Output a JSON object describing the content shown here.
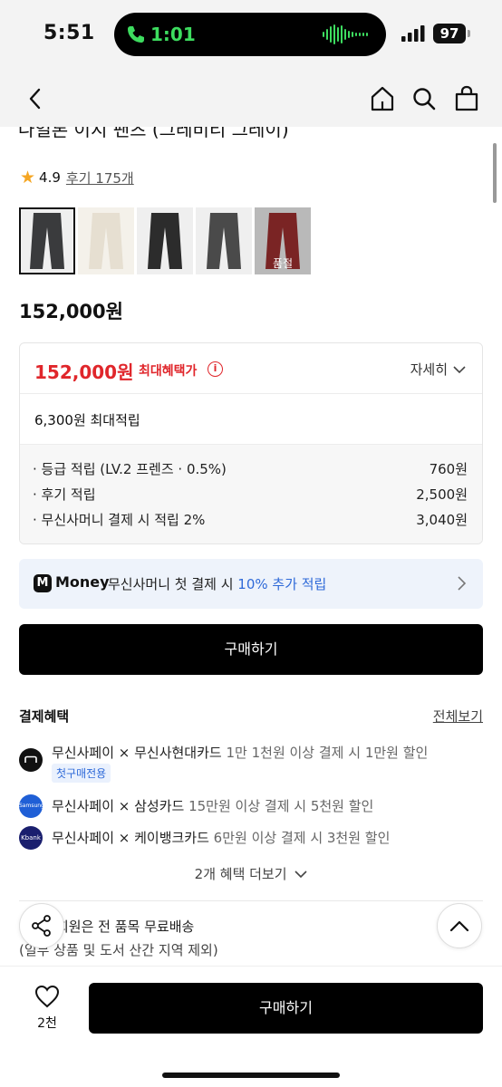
{
  "status": {
    "time": "5:51",
    "call_time": "1:01",
    "battery": "97"
  },
  "nav": {
    "back_icon": "chevron-left-icon",
    "home_icon": "home-icon",
    "search_icon": "search-icon",
    "bag_icon": "bag-icon"
  },
  "product": {
    "title": "나일론 이지 팬츠 (그레비티 그레이)",
    "rating": "4.9",
    "reviews": "후기 175개",
    "price": "152,000원",
    "thumbnails": [
      {
        "color": "#3a3b3d",
        "selected": true,
        "sold_out": ""
      },
      {
        "color": "#e6dfd1",
        "selected": false,
        "sold_out": ""
      },
      {
        "color": "#2c2c2c",
        "selected": false,
        "sold_out": ""
      },
      {
        "color": "#4a4a4a",
        "selected": false,
        "sold_out": ""
      },
      {
        "color": "#7a2424",
        "selected": false,
        "sold_out": "품절"
      }
    ]
  },
  "benefit": {
    "max_price": "152,000원",
    "max_label": "최대혜택가",
    "detail_toggle": "자세히",
    "points_total": "6,300원 최대적립",
    "points": [
      {
        "label": "· 등급 적립 (LV.2 프렌즈 · 0.5%)",
        "amount": "760원"
      },
      {
        "label": "· 후기 적립",
        "amount": "2,500원"
      },
      {
        "label": "· 무신사머니 결제 시 적립 2%",
        "amount": "3,040원"
      }
    ]
  },
  "money": {
    "logo": "M",
    "brand": "Money",
    "text_before": "무신사머니 첫 결제 시 ",
    "highlight": "10% 추가 적립"
  },
  "buy_label": "구매하기",
  "payment": {
    "heading": "결제혜택",
    "view_all": "전체보기",
    "items": [
      {
        "main": "무신사페이 × 무신사현대카드",
        "sub": " 1만 1천원 이상 결제 시 1만원 할인",
        "logo_color": "#111111",
        "tag": "첫구매전용"
      },
      {
        "main": "무신사페이 × 삼성카드",
        "sub": " 15만원 이상 결제 시 5천원 할인",
        "logo_color": "#1f5fd6",
        "logo_text": "Samsung Card"
      },
      {
        "main": "무신사페이 × 케이뱅크카드",
        "sub": " 6만원 이상 결제 시 3천원 할인",
        "logo_color": "#1a1f6e",
        "logo_text": "Kbank"
      }
    ],
    "more": "2개 혜택 더보기"
  },
  "shipping": {
    "line1": "회원은 전 품목 무료배송",
    "line2": "(일부 상품 및 도서 산간 지역 제외)"
  },
  "bottom": {
    "like_count": "2천",
    "buy_label": "구매하기"
  }
}
